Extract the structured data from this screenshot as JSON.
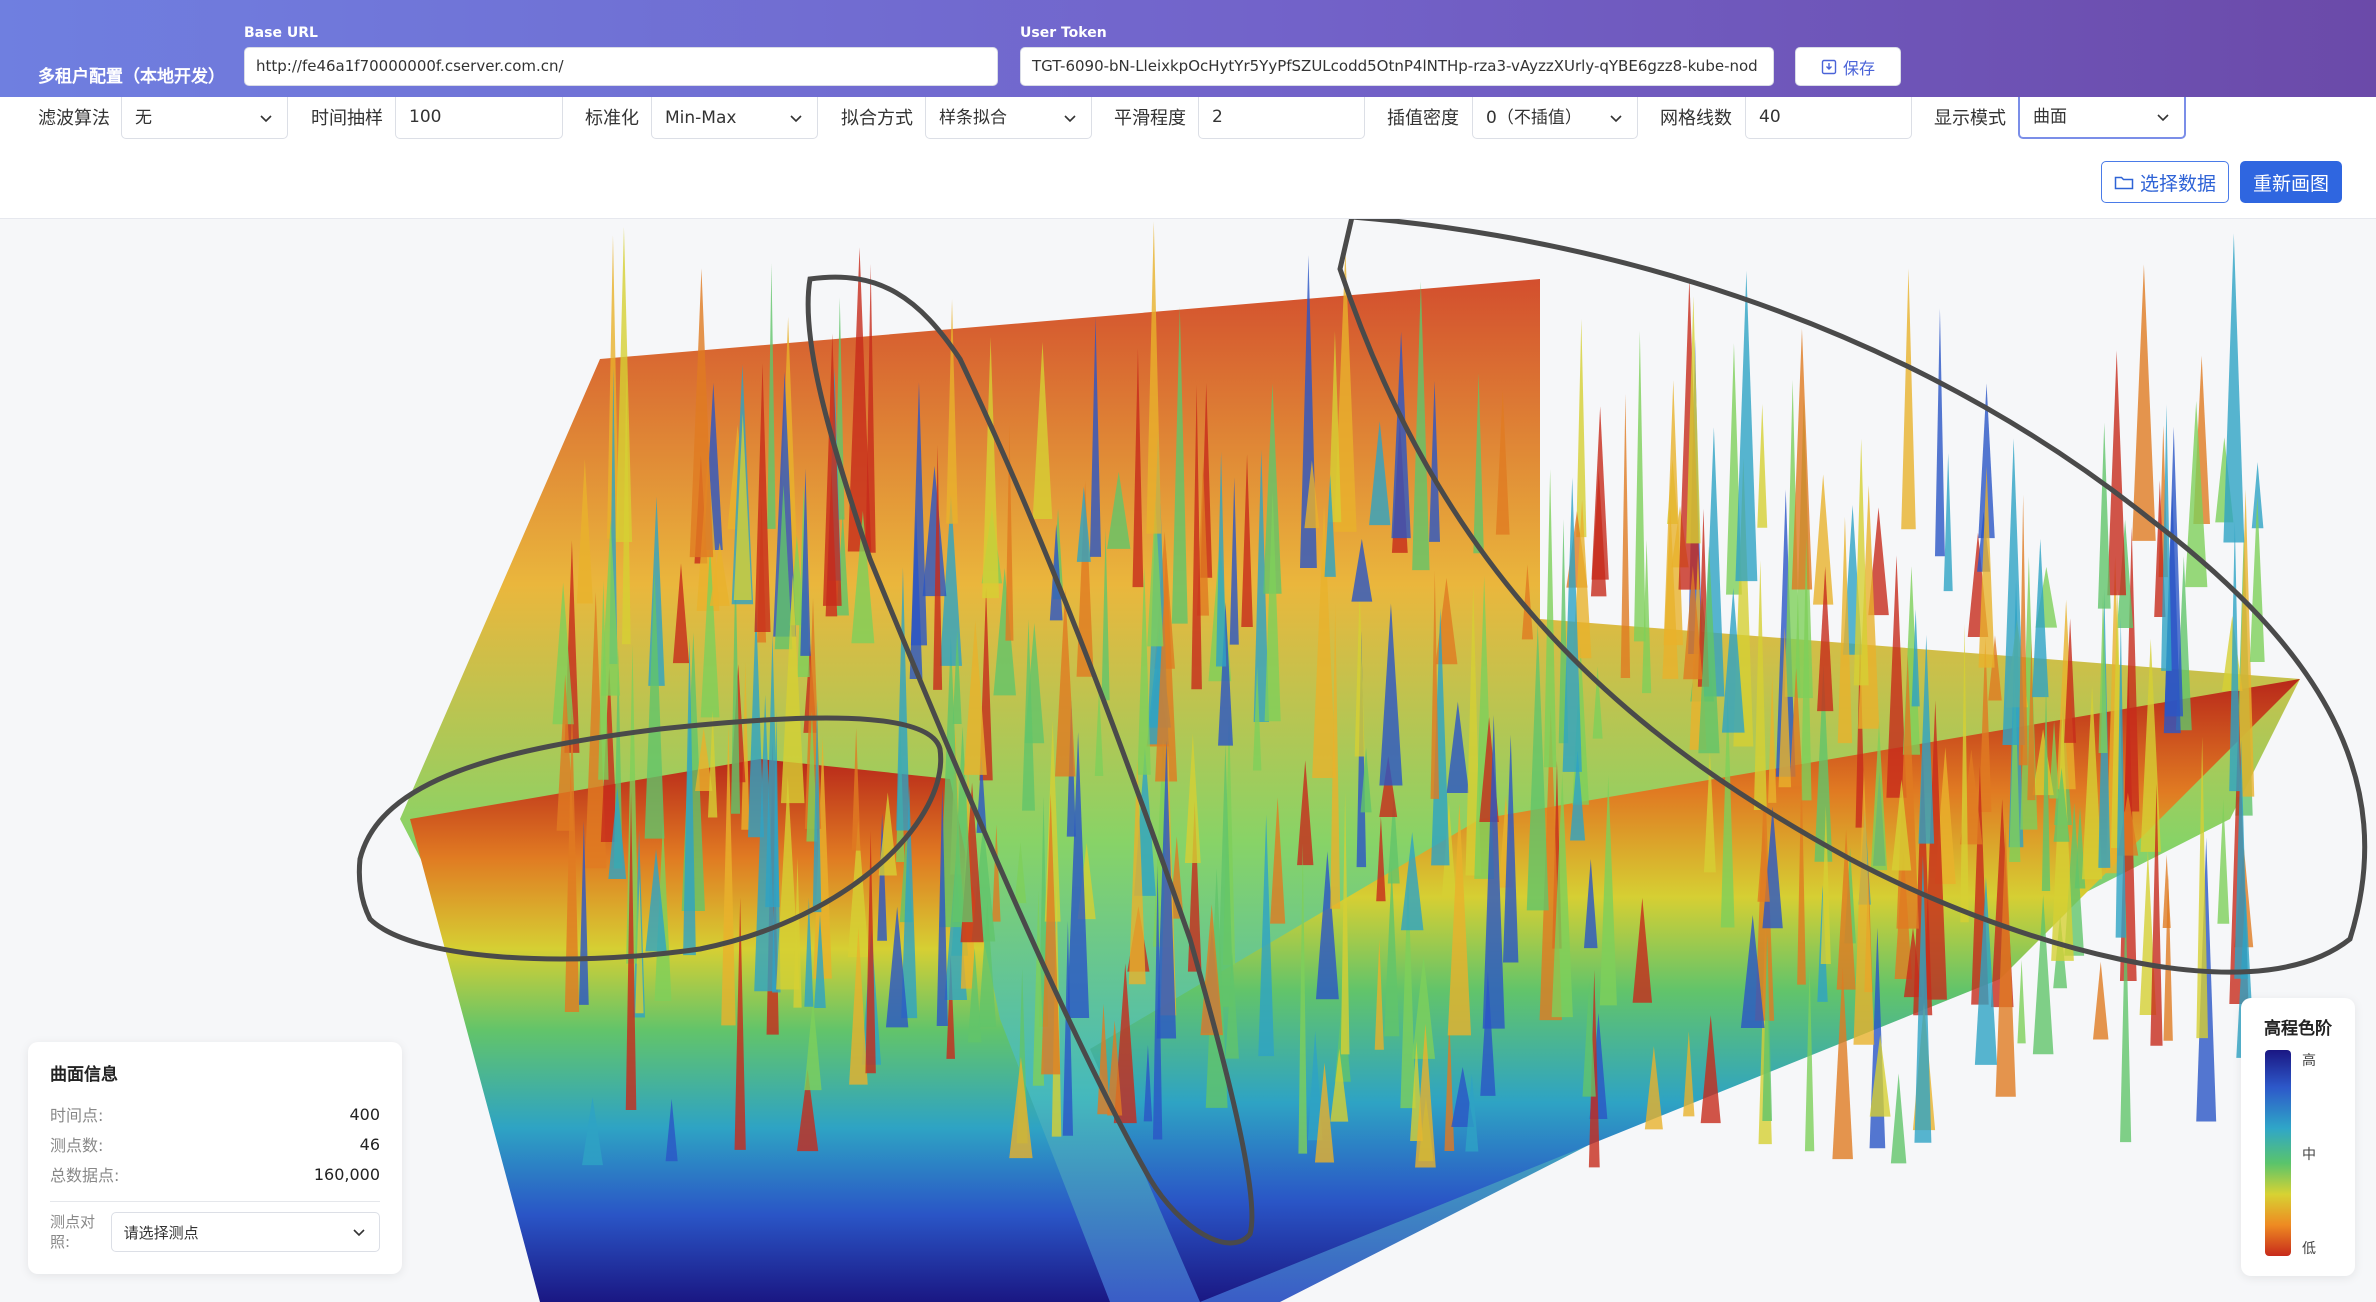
{
  "header": {
    "title": "多租户配置（本地开发）",
    "base_url_label": "Base URL",
    "base_url_value": "http://fe46a1f70000000f.cserver.com.cn/",
    "token_label": "User Token",
    "token_value": "TGT-6090-bN-LleixkpOcHytYr5YyPfSZULcodd5OtnP4lNTHp-rza3-vAyzzXUrly-qYBE6gzz8-kube-nod",
    "save_label": "保存"
  },
  "controls": {
    "filter": {
      "label": "滤波算法",
      "value": "无"
    },
    "sampling": {
      "label": "时间抽样",
      "value": "100"
    },
    "normalize": {
      "label": "标准化",
      "value": "Min-Max"
    },
    "fit": {
      "label": "拟合方式",
      "value": "样条拟合"
    },
    "smooth": {
      "label": "平滑程度",
      "value": "2"
    },
    "interp": {
      "label": "插值密度",
      "value": "0（不插值）"
    },
    "grid": {
      "label": "网格线数",
      "value": "40"
    },
    "display": {
      "label": "显示模式",
      "value": "曲面"
    },
    "select_data_label": "选择数据",
    "redraw_label": "重新画图"
  },
  "info": {
    "title": "曲面信息",
    "rows": [
      {
        "k": "时间点:",
        "v": "400"
      },
      {
        "k": "测点数:",
        "v": "46"
      },
      {
        "k": "总数据点:",
        "v": "160,000"
      }
    ],
    "compare_label": "测点对照:",
    "compare_placeholder": "请选择测点"
  },
  "legend": {
    "title": "高程色阶",
    "high": "高",
    "mid": "中",
    "low": "低"
  },
  "colors": {
    "accent": "#2f66e0",
    "header_start": "#6f7fe0",
    "header_end": "#6b4aa9",
    "surface_high": "#c72a1b",
    "surface_mid": "#5ac46b",
    "surface_low": "#1a1783",
    "annotation_stroke": "#4a4a4a"
  }
}
